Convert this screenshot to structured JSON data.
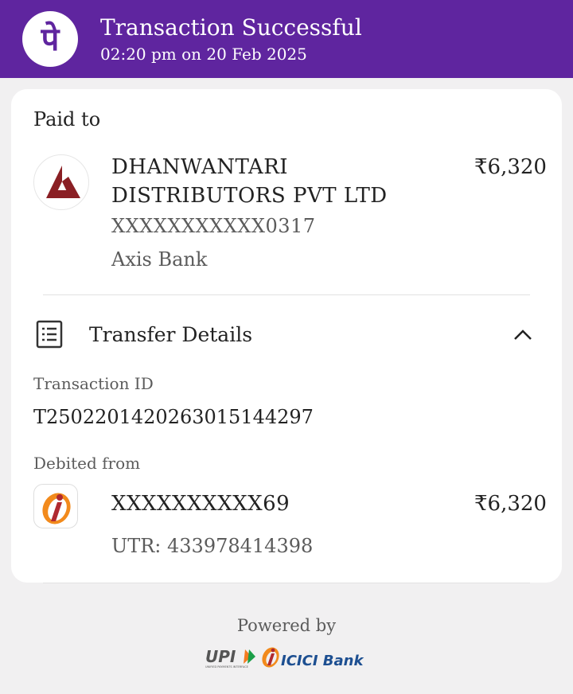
{
  "header": {
    "title": "Transaction Successful",
    "datetime": "02:20 pm on 20 Feb 2025",
    "brand_color": "#5f259f",
    "brand_icon": "phonepe-logo"
  },
  "paid_to": {
    "label": "Paid to",
    "name": "DHANWANTARI DISTRIBUTORS PVT LTD",
    "amount": "₹6,320",
    "account": "XXXXXXXXXXX0317",
    "bank": "Axis Bank",
    "logo_icon": "axis-bank-logo"
  },
  "transfer_details": {
    "title": "Transfer Details",
    "icon": "document-list-icon",
    "toggle_icon": "chevron-up-icon",
    "transaction_id_label": "Transaction ID",
    "transaction_id": "T2502201420263015144297",
    "debited_from_label": "Debited from",
    "debit_account": "XXXXXXXXXX69",
    "debit_amount": "₹6,320",
    "utr": "UTR: 433978414398",
    "debit_bank_icon": "icici-bank-logo"
  },
  "footer": {
    "powered_by": "Powered by",
    "upi_mark": "UPI",
    "upi_tagline": "UNIFIED PAYMENTS INTERFACE",
    "bank_mark": "ICICI Bank"
  }
}
